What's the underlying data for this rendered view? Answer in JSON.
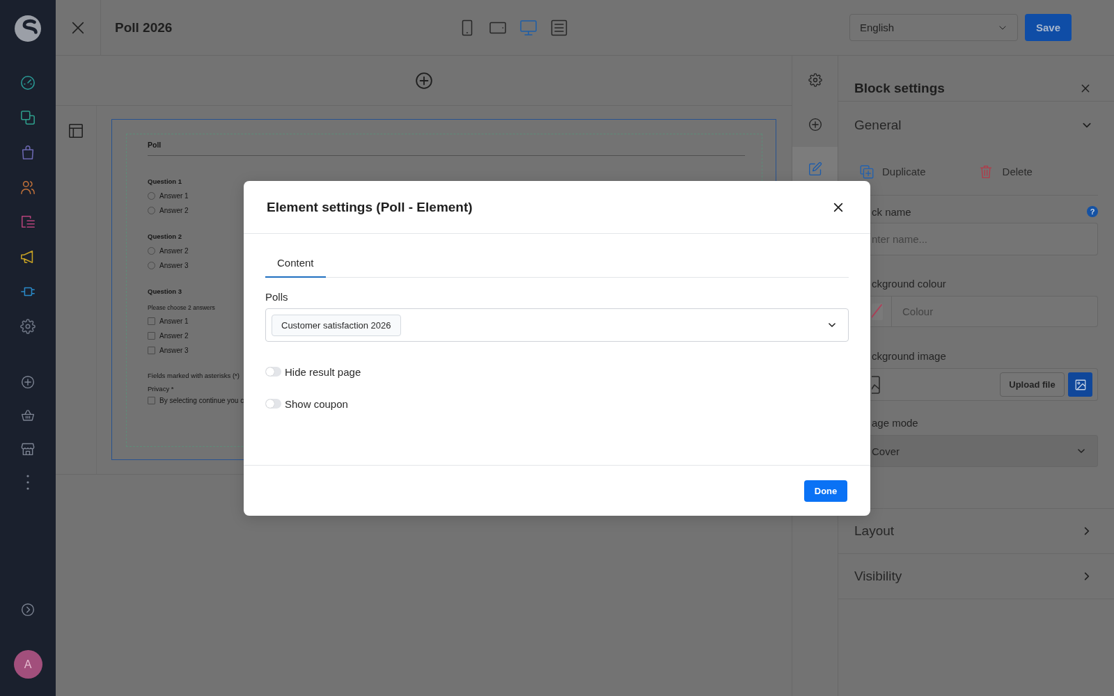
{
  "sidebar": {
    "items": [
      {
        "kind": "gauge",
        "color": "#2a9a96"
      },
      {
        "kind": "layers",
        "color": "#2e9d8b"
      },
      {
        "kind": "bag",
        "color": "#6b67b0"
      },
      {
        "kind": "users",
        "color": "#c0713a"
      },
      {
        "kind": "list",
        "color": "#b5427a"
      },
      {
        "kind": "megaphone",
        "color": "#c6a124"
      },
      {
        "kind": "plug",
        "color": "#2a89c8"
      },
      {
        "kind": "gear",
        "color": "#6e7584"
      }
    ],
    "shortcuts": [
      {
        "kind": "plus"
      },
      {
        "kind": "basket"
      },
      {
        "kind": "store"
      },
      {
        "kind": "more"
      }
    ],
    "avatar": "A"
  },
  "topbar": {
    "title": "Poll 2026",
    "viewports": [
      {
        "kind": "mobile",
        "selected": false
      },
      {
        "kind": "tablet",
        "selected": false
      },
      {
        "kind": "desktop",
        "selected": true
      },
      {
        "kind": "outline",
        "selected": false
      }
    ],
    "language": "English",
    "save": "Save"
  },
  "canvas": {
    "preview": {
      "title": "Poll",
      "questions": [
        {
          "title": "Question 1",
          "kind": "radio",
          "answers": [
            {
              "label": "Answer 1",
              "checked": false
            },
            {
              "label": "Answer 2",
              "checked": false
            }
          ]
        },
        {
          "title": "Question 2",
          "kind": "radio",
          "answers": [
            {
              "label": "Answer 2",
              "checked": false
            },
            {
              "label": "Answer 3",
              "checked": false
            }
          ]
        },
        {
          "title": "Question 3",
          "kind": "checkbox",
          "hint": "Please choose 2 answers",
          "answers": [
            {
              "label": "Answer 1",
              "checked": false
            },
            {
              "label": "Answer 2",
              "checked": false
            },
            {
              "label": "Answer 3",
              "checked": false
            }
          ]
        }
      ],
      "note": "Fields marked with asterisks (*)",
      "privacy_label": "Privacy *",
      "privacy": {
        "label": "By selecting continue you c",
        "checked": false
      }
    }
  },
  "tools": [
    {
      "kind": "settings",
      "selected": false
    },
    {
      "kind": "add",
      "selected": false
    },
    {
      "kind": "edit",
      "selected": true
    }
  ],
  "block_settings": {
    "title": "Block settings",
    "general": {
      "title": "General",
      "expanded": true,
      "actions": [
        {
          "kind": "duplicate",
          "label": "Duplicate"
        },
        {
          "kind": "delete",
          "label": "Delete"
        }
      ],
      "fields": [
        {
          "kind": "text",
          "label": "ck name",
          "placeholder": "nter name...",
          "help": "?"
        },
        {
          "kind": "color",
          "label": "ckground colour",
          "placeholder": "Colour"
        },
        {
          "kind": "image",
          "label": "ckground image",
          "button": "Upload file"
        },
        {
          "kind": "select",
          "label": "age mode",
          "value": "Cover"
        }
      ]
    },
    "sections": [
      {
        "title": "Layout",
        "expanded": false
      },
      {
        "title": "Visibility",
        "expanded": false
      }
    ]
  },
  "modal": {
    "title": "Element settings (Poll - Element)",
    "tabs": [
      {
        "label": "Content",
        "selected": true
      }
    ],
    "polls": {
      "label": "Polls",
      "chips": [
        "Customer satisfaction 2026"
      ]
    },
    "toggles": [
      {
        "label": "Hide result page",
        "on": false
      },
      {
        "label": "Show coupon",
        "on": false
      }
    ],
    "done": "Done"
  }
}
